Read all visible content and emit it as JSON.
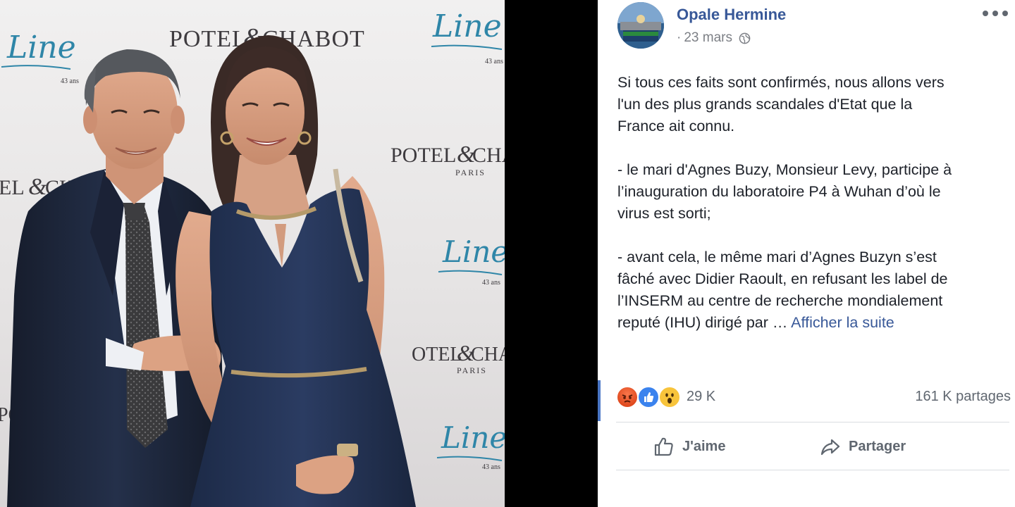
{
  "photo": {
    "description_label": "Photo",
    "backdrop": {
      "logos": [
        {
          "main": "POTEL",
          "sep": "&",
          "tail": "CHABOT",
          "sub": ""
        },
        {
          "main": "POTEL",
          "sep": "&",
          "tail": "CHA",
          "sub": "PARIS"
        },
        {
          "main": "EL",
          "sep": "&",
          "tail": "CH",
          "sub": ""
        },
        {
          "main": "OTEL",
          "sep": "&",
          "tail": "CHA",
          "sub": "PARIS"
        },
        {
          "main": "POTEL",
          "sep": "",
          "tail": "",
          "sub": ""
        }
      ],
      "script_logos": [
        {
          "text": "Line",
          "sub": "43 ans"
        },
        {
          "text": "Line",
          "sub": "43 ans"
        },
        {
          "text": "Line",
          "sub": "43 ans"
        },
        {
          "text": "Line",
          "sub": "43 ans"
        }
      ]
    }
  },
  "post": {
    "author": "Opale Hermine",
    "date": "23 mars",
    "paragraphs": [
      "Si tous ces faits sont confirmés, nous allons vers\nl'un des plus grands scandales d'Etat que la\nFrance ait connu.",
      "- le mari d'Agnes Buzy, Monsieur Levy, participe à\nl’inauguration du laboratoire P4 à Wuhan d’où le\nvirus est sorti;",
      "- avant cela, le même mari d’Agnes Buzyn s’est\nfâché avec Didier Raoult, en refusant les label de\nl’INSERM au centre de recherche mondialement\nreputé (IHU) dirigé par …"
    ],
    "see_more": "Afficher la suite",
    "reaction_count": "29 K",
    "shares": "161 K partages",
    "actions": {
      "like": "J'aime",
      "share": "Partager"
    },
    "reaction_types": [
      "angry",
      "like",
      "wow"
    ],
    "colors": {
      "link": "#385898",
      "text": "#1d2129",
      "muted": "#606770"
    }
  }
}
